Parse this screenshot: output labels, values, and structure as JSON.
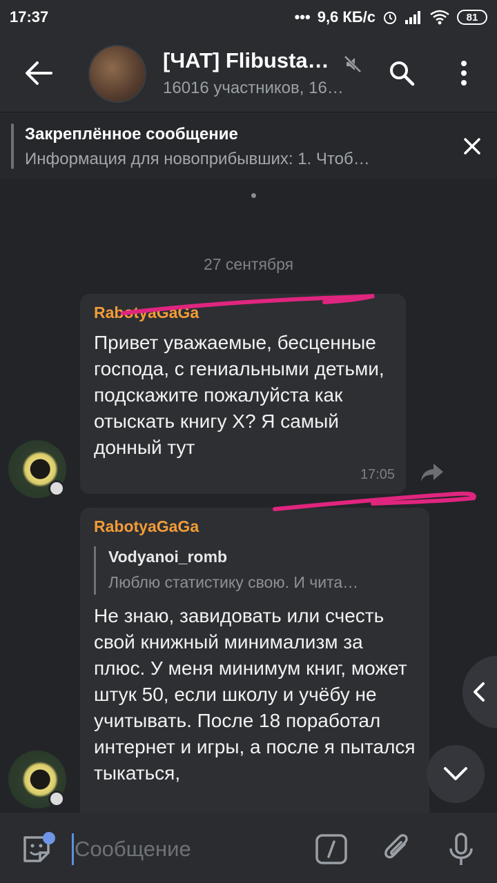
{
  "status_bar": {
    "time": "17:37",
    "network_speed": "9,6 КБ/с",
    "battery": "81",
    "icons": [
      "dots-icon",
      "alarm-icon",
      "signal-icon",
      "wifi-icon",
      "battery-icon"
    ]
  },
  "header": {
    "title": "[ЧАТ] Flibusta…",
    "subtitle": "16016 участников, 16…",
    "muted": true
  },
  "pinned": {
    "title": "Закреплённое сообщение",
    "text": "Информация для новоприбывших:  1. Чтоб…"
  },
  "chat": {
    "date_separator": "27 сентября",
    "messages": [
      {
        "author": "RabotyaGaGa",
        "text": "Привет уважаемые, бесценные господа, с гениальными детьми, подскажите пожалуйста как отыскать книгу Х? Я самый донный тут",
        "time": "17:05"
      },
      {
        "author": "RabotyaGaGa",
        "reply_to": {
          "author": "Vodyanoi_romb",
          "text": "Люблю статистику свою. И чита…"
        },
        "text": "Не знаю, завидовать или счесть свой книжный минимализм за плюс. У меня минимум книг, может штук 50, если школу и учёбу не учитывать. После 18 поработал интернет и игры, а после я пытался тыкаться,"
      }
    ]
  },
  "input": {
    "placeholder": "Сообщение",
    "value": ""
  },
  "colors": {
    "accent_author": "#f39c38",
    "highlight_stroke": "#e0257f",
    "background": "#232428"
  }
}
